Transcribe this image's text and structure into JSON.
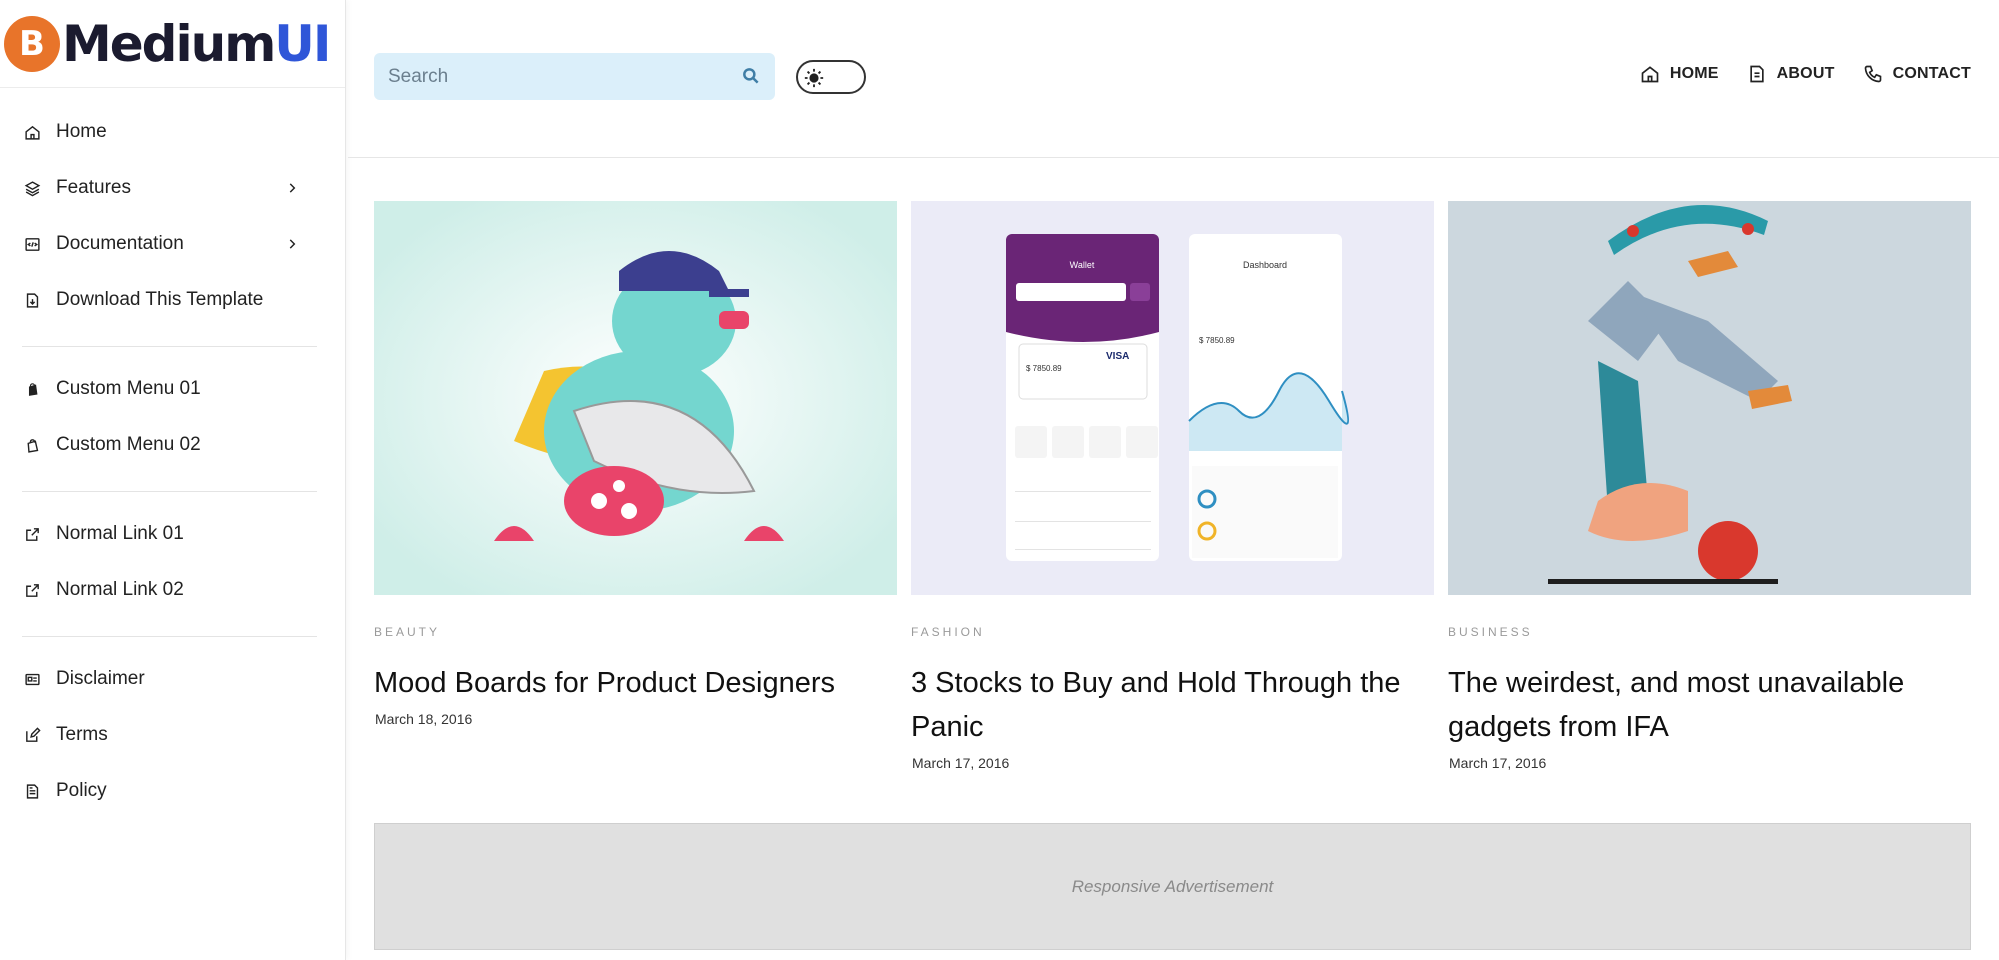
{
  "brand": {
    "part1": "Medium",
    "part2": "UI",
    "badge_letter": "B",
    "badge_color": "#e8742a",
    "accent": "#2f56d8"
  },
  "sidebar": {
    "groups": [
      [
        {
          "label": "Home",
          "icon": "home-icon"
        },
        {
          "label": "Features",
          "icon": "layers-icon",
          "has_submenu": true
        },
        {
          "label": "Documentation",
          "icon": "code-icon",
          "has_submenu": true
        },
        {
          "label": "Download This Template",
          "icon": "download-file-icon"
        }
      ],
      [
        {
          "label": "Custom Menu 01",
          "icon": "shop-bag-icon"
        },
        {
          "label": "Custom Menu 02",
          "icon": "shop-bag-icon"
        }
      ],
      [
        {
          "label": "Normal Link 01",
          "icon": "external-link-icon"
        },
        {
          "label": "Normal Link 02",
          "icon": "external-link-icon"
        }
      ],
      [
        {
          "label": "Disclaimer",
          "icon": "id-card-icon"
        },
        {
          "label": "Terms",
          "icon": "edit-icon"
        },
        {
          "label": "Policy",
          "icon": "document-icon"
        }
      ]
    ]
  },
  "header": {
    "search_placeholder": "Search",
    "nav": [
      {
        "label": "HOME",
        "icon": "home-icon"
      },
      {
        "label": "ABOUT",
        "icon": "file-icon"
      },
      {
        "label": "CONTACT",
        "icon": "phone-icon"
      }
    ]
  },
  "posts": [
    {
      "category": "BEAUTY",
      "title": "Mood Boards for Product Designers",
      "date": "March 18, 2016",
      "thumb_bg": "#d6f1ec"
    },
    {
      "category": "FASHION",
      "title": "3 Stocks to Buy and Hold Through the Panic",
      "date": "March 17, 2016",
      "thumb_bg": "#ebebf7"
    },
    {
      "category": "BUSINESS",
      "title": "The weirdest, and most unavailable gadgets from IFA",
      "date": "March 17, 2016",
      "thumb_bg": "#ccd7de"
    }
  ],
  "ad": {
    "text": "Responsive Advertisement"
  },
  "mockups": {
    "wallet_title": "Wallet",
    "wallet_amount": "$ 7850.89",
    "dashboard_title": "Dashboard",
    "dashboard_amount": "$ 7850.89",
    "brand": "VISA"
  }
}
